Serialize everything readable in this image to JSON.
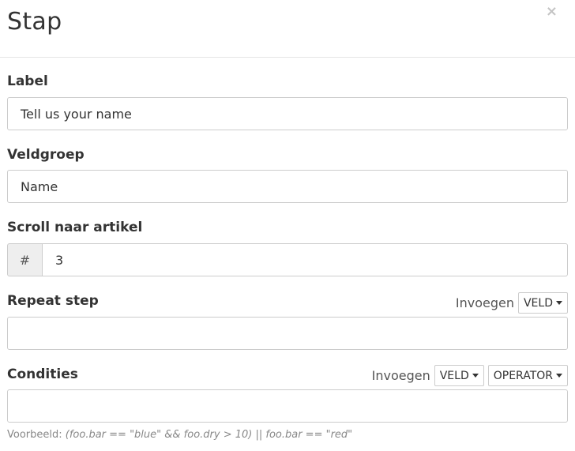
{
  "modal": {
    "title": "Stap",
    "close_label": "×"
  },
  "label_field": {
    "label": "Label",
    "value": "Tell us your name"
  },
  "fieldgroup_field": {
    "label": "Veldgroep",
    "value": "Name"
  },
  "scroll_field": {
    "label": "Scroll naar artikel",
    "addon": "#",
    "value": "3"
  },
  "repeat_field": {
    "label": "Repeat step",
    "insert_label": "Invoegen",
    "field_dropdown": "VELD",
    "value": ""
  },
  "conditions_field": {
    "label": "Condities",
    "insert_label": "Invoegen",
    "field_dropdown": "VELD",
    "operator_dropdown": "OPERATOR",
    "value": ""
  },
  "help": {
    "prefix": "Voorbeeld: ",
    "example": "(foo.bar == \"blue\" && foo.dry > 10) || foo.bar == \"red\""
  }
}
